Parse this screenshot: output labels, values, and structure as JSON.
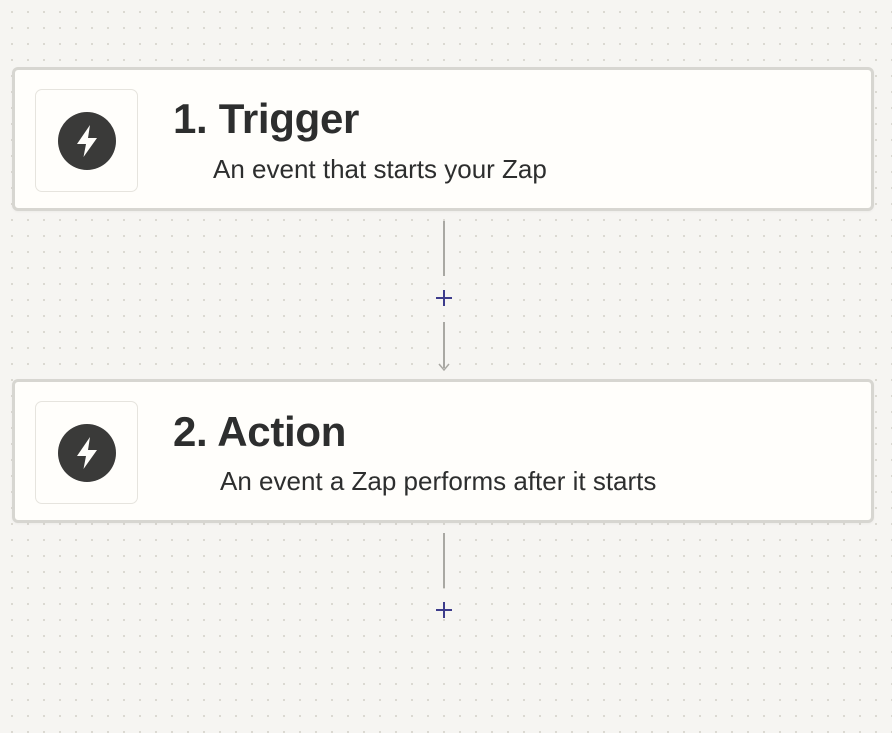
{
  "steps": [
    {
      "title": "1. Trigger",
      "description": "An event that starts your Zap",
      "icon": "bolt-icon"
    },
    {
      "title": "2. Action",
      "description": "An event a Zap performs after it starts",
      "icon": "bolt-icon"
    }
  ],
  "connectors": [
    {
      "add_icon": "plus-icon"
    },
    {
      "add_icon": "plus-icon"
    }
  ],
  "colors": {
    "background": "#f6f5f2",
    "card": "#fffefb",
    "card_border": "#d7d6d1",
    "icon_fill": "#3a3a39",
    "plus_accent": "#3d3c8c",
    "text": "#2d2e2e"
  }
}
